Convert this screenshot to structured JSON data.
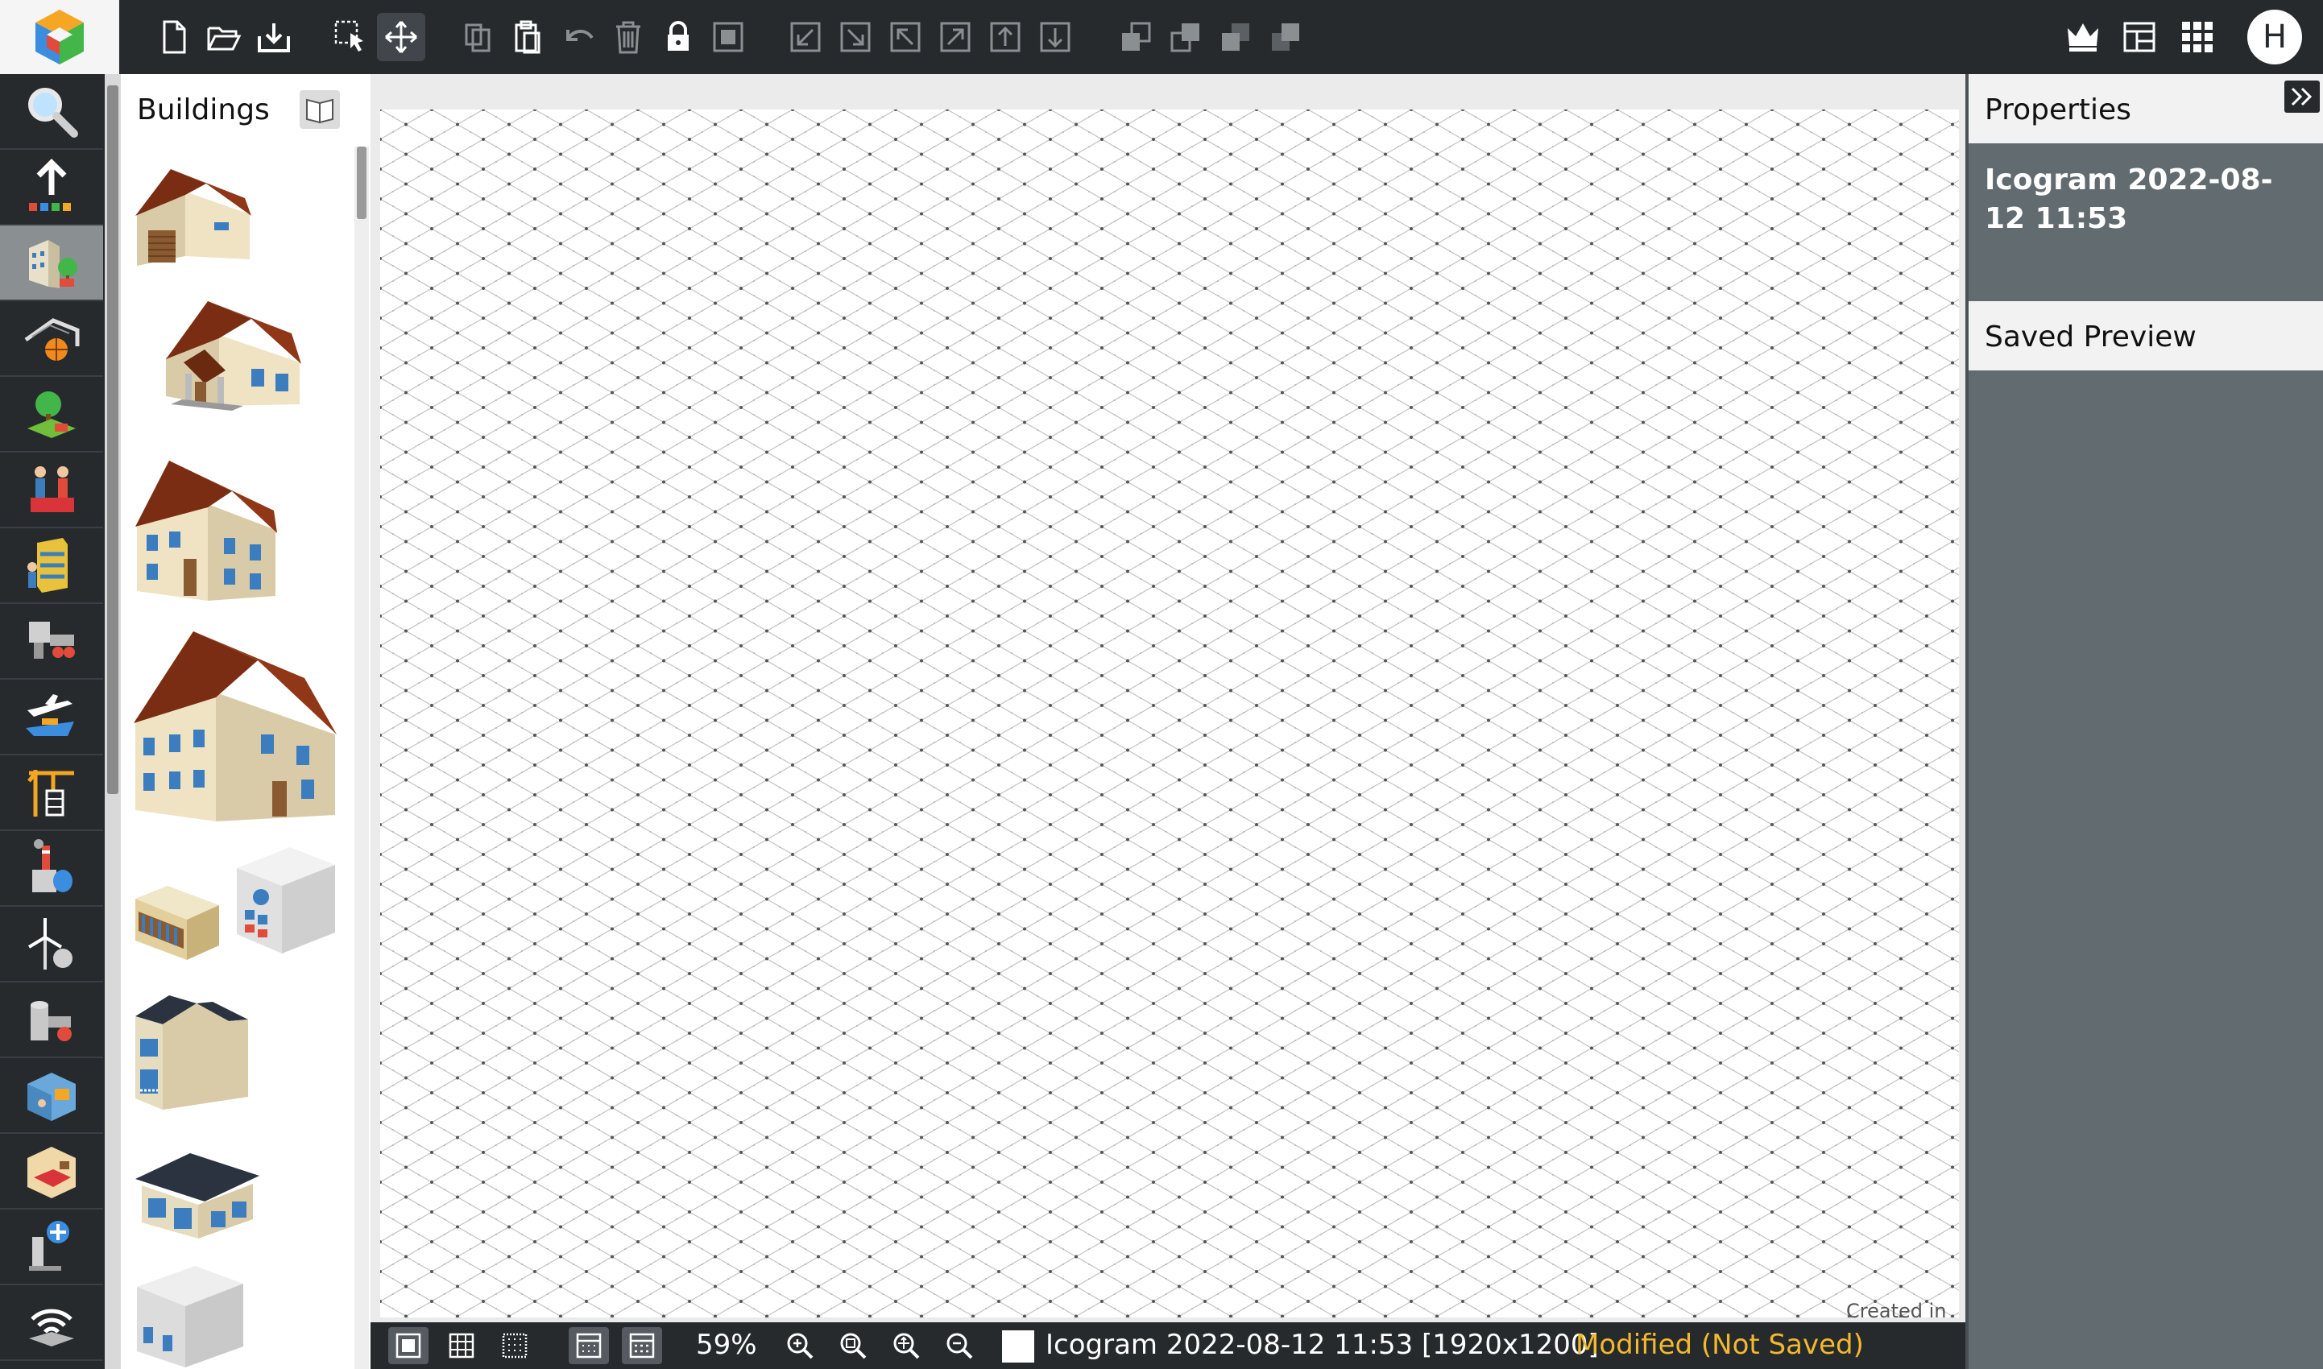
{
  "toolbar": {
    "icons": [
      "new-file",
      "open-folder",
      "save-download",
      "marquee-select",
      "move",
      "copy",
      "paste",
      "undo",
      "delete",
      "lock",
      "group",
      "align-bottom-left",
      "align-bottom-right",
      "align-top-left",
      "align-top-right",
      "move-to-top",
      "move-to-bottom",
      "bring-forward",
      "send-backward",
      "bring-to-front",
      "send-to-back",
      "premium-crown",
      "layout",
      "apps-grid"
    ],
    "active": "move",
    "user_initial": "H"
  },
  "categories": {
    "items": [
      "search",
      "arrows-upload",
      "buildings",
      "sports",
      "nature",
      "people",
      "shelving",
      "machines",
      "transport",
      "construction",
      "industry",
      "energy",
      "piping",
      "office",
      "furniture",
      "science",
      "network"
    ],
    "active": "buildings"
  },
  "library": {
    "title": "Buildings",
    "shapes": [
      "house-small-garage",
      "house-porch",
      "house-two-storey",
      "house-large",
      "shop-small",
      "office-block",
      "townhouse",
      "bungalow-dark-roof",
      "cube-building"
    ]
  },
  "canvas": {
    "grid": "isometric",
    "watermark": "Created in"
  },
  "statusbar": {
    "view_modes": [
      "grid-view",
      "dot-grid",
      "fine-grid",
      "snap-grid",
      "iso-grid"
    ],
    "active_modes": [
      "grid-view",
      "snap-grid",
      "iso-grid"
    ],
    "zoom": "59%",
    "doc_title": "Icogram 2022-08-12 11:53 [1920x1200]",
    "doc_status": "Modified (Not Saved)"
  },
  "properties": {
    "title": "Properties",
    "doc_name": "Icogram 2022-08-12 11:53",
    "saved_preview": "Saved Preview"
  },
  "colors": {
    "dark": "#262a2d",
    "panel": "#626b70",
    "status_warning": "#f2b92c",
    "roof": "#7a2d12",
    "wall": "#e8dcc0"
  }
}
